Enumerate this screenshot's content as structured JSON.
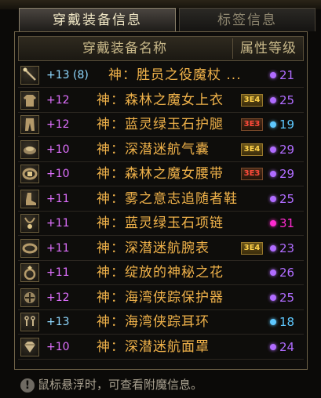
{
  "tabs": [
    {
      "label": "穿戴装备信息",
      "active": true
    },
    {
      "label": "标签信息",
      "active": false
    }
  ],
  "table": {
    "col_name": "穿戴装备名称",
    "col_level": "属性等级"
  },
  "rows": [
    {
      "icon": "staff-icon",
      "plus": "+13 (8)",
      "plus_color": "#8fd8ff",
      "name": "神：胜员之役魔杖 ...",
      "badge": "",
      "badge_type": "",
      "dot_color": "#b06cff",
      "level": "21",
      "level_color": "#b06cff"
    },
    {
      "icon": "coat-icon",
      "plus": "+12",
      "plus_color": "#e070ff",
      "name": "神：森林之魔女上衣",
      "badge": "3E4",
      "badge_type": "gold",
      "dot_color": "#b06cff",
      "level": "25",
      "level_color": "#b06cff"
    },
    {
      "icon": "pants-icon",
      "plus": "+12",
      "plus_color": "#e070ff",
      "name": "神：蓝灵绿玉石护腿",
      "badge": "3E3",
      "badge_type": "red",
      "dot_color": "#5ec8ff",
      "level": "19",
      "level_color": "#5ec8ff"
    },
    {
      "icon": "shoulder-icon",
      "plus": "+10",
      "plus_color": "#e070ff",
      "name": "神：深潜迷航气囊",
      "badge": "3E4",
      "badge_type": "gold",
      "dot_color": "#b06cff",
      "level": "29",
      "level_color": "#b06cff"
    },
    {
      "icon": "belt-icon",
      "plus": "+10",
      "plus_color": "#e070ff",
      "name": "神：森林之魔女腰带",
      "badge": "3E3",
      "badge_type": "red",
      "dot_color": "#b06cff",
      "level": "29",
      "level_color": "#b06cff"
    },
    {
      "icon": "boots-icon",
      "plus": "+11",
      "plus_color": "#e070ff",
      "name": "神：雾之意志追随者鞋",
      "badge": "",
      "badge_type": "",
      "dot_color": "#b06cff",
      "level": "25",
      "level_color": "#b06cff"
    },
    {
      "icon": "necklace-icon",
      "plus": "+11",
      "plus_color": "#e070ff",
      "name": "神：蓝灵绿玉石项链",
      "badge": "",
      "badge_type": "",
      "dot_color": "#ff2ad0",
      "level": "31",
      "level_color": "#ff2ad0"
    },
    {
      "icon": "bracelet-icon",
      "plus": "+11",
      "plus_color": "#e070ff",
      "name": "神：深潜迷航腕表",
      "badge": "3E4",
      "badge_type": "gold",
      "dot_color": "#b06cff",
      "level": "23",
      "level_color": "#b06cff"
    },
    {
      "icon": "ring-icon",
      "plus": "+11",
      "plus_color": "#e070ff",
      "name": "神：绽放的神秘之花",
      "badge": "",
      "badge_type": "",
      "dot_color": "#b06cff",
      "level": "26",
      "level_color": "#b06cff"
    },
    {
      "icon": "support-icon",
      "plus": "+12",
      "plus_color": "#e070ff",
      "name": "神：海湾侠踪保护器",
      "badge": "",
      "badge_type": "",
      "dot_color": "#b06cff",
      "level": "25",
      "level_color": "#b06cff"
    },
    {
      "icon": "earring-icon",
      "plus": "+13",
      "plus_color": "#8fd8ff",
      "name": "神：海湾侠踪耳环",
      "badge": "",
      "badge_type": "",
      "dot_color": "#5ec8ff",
      "level": "18",
      "level_color": "#5ec8ff"
    },
    {
      "icon": "gem-icon",
      "plus": "+10",
      "plus_color": "#e070ff",
      "name": "神：深潜迷航面罩",
      "badge": "",
      "badge_type": "",
      "dot_color": "#b06cff",
      "level": "24",
      "level_color": "#b06cff"
    }
  ],
  "footer": {
    "icon": "info-icon",
    "text": "鼠标悬浮时，可查看附魔信息。"
  }
}
